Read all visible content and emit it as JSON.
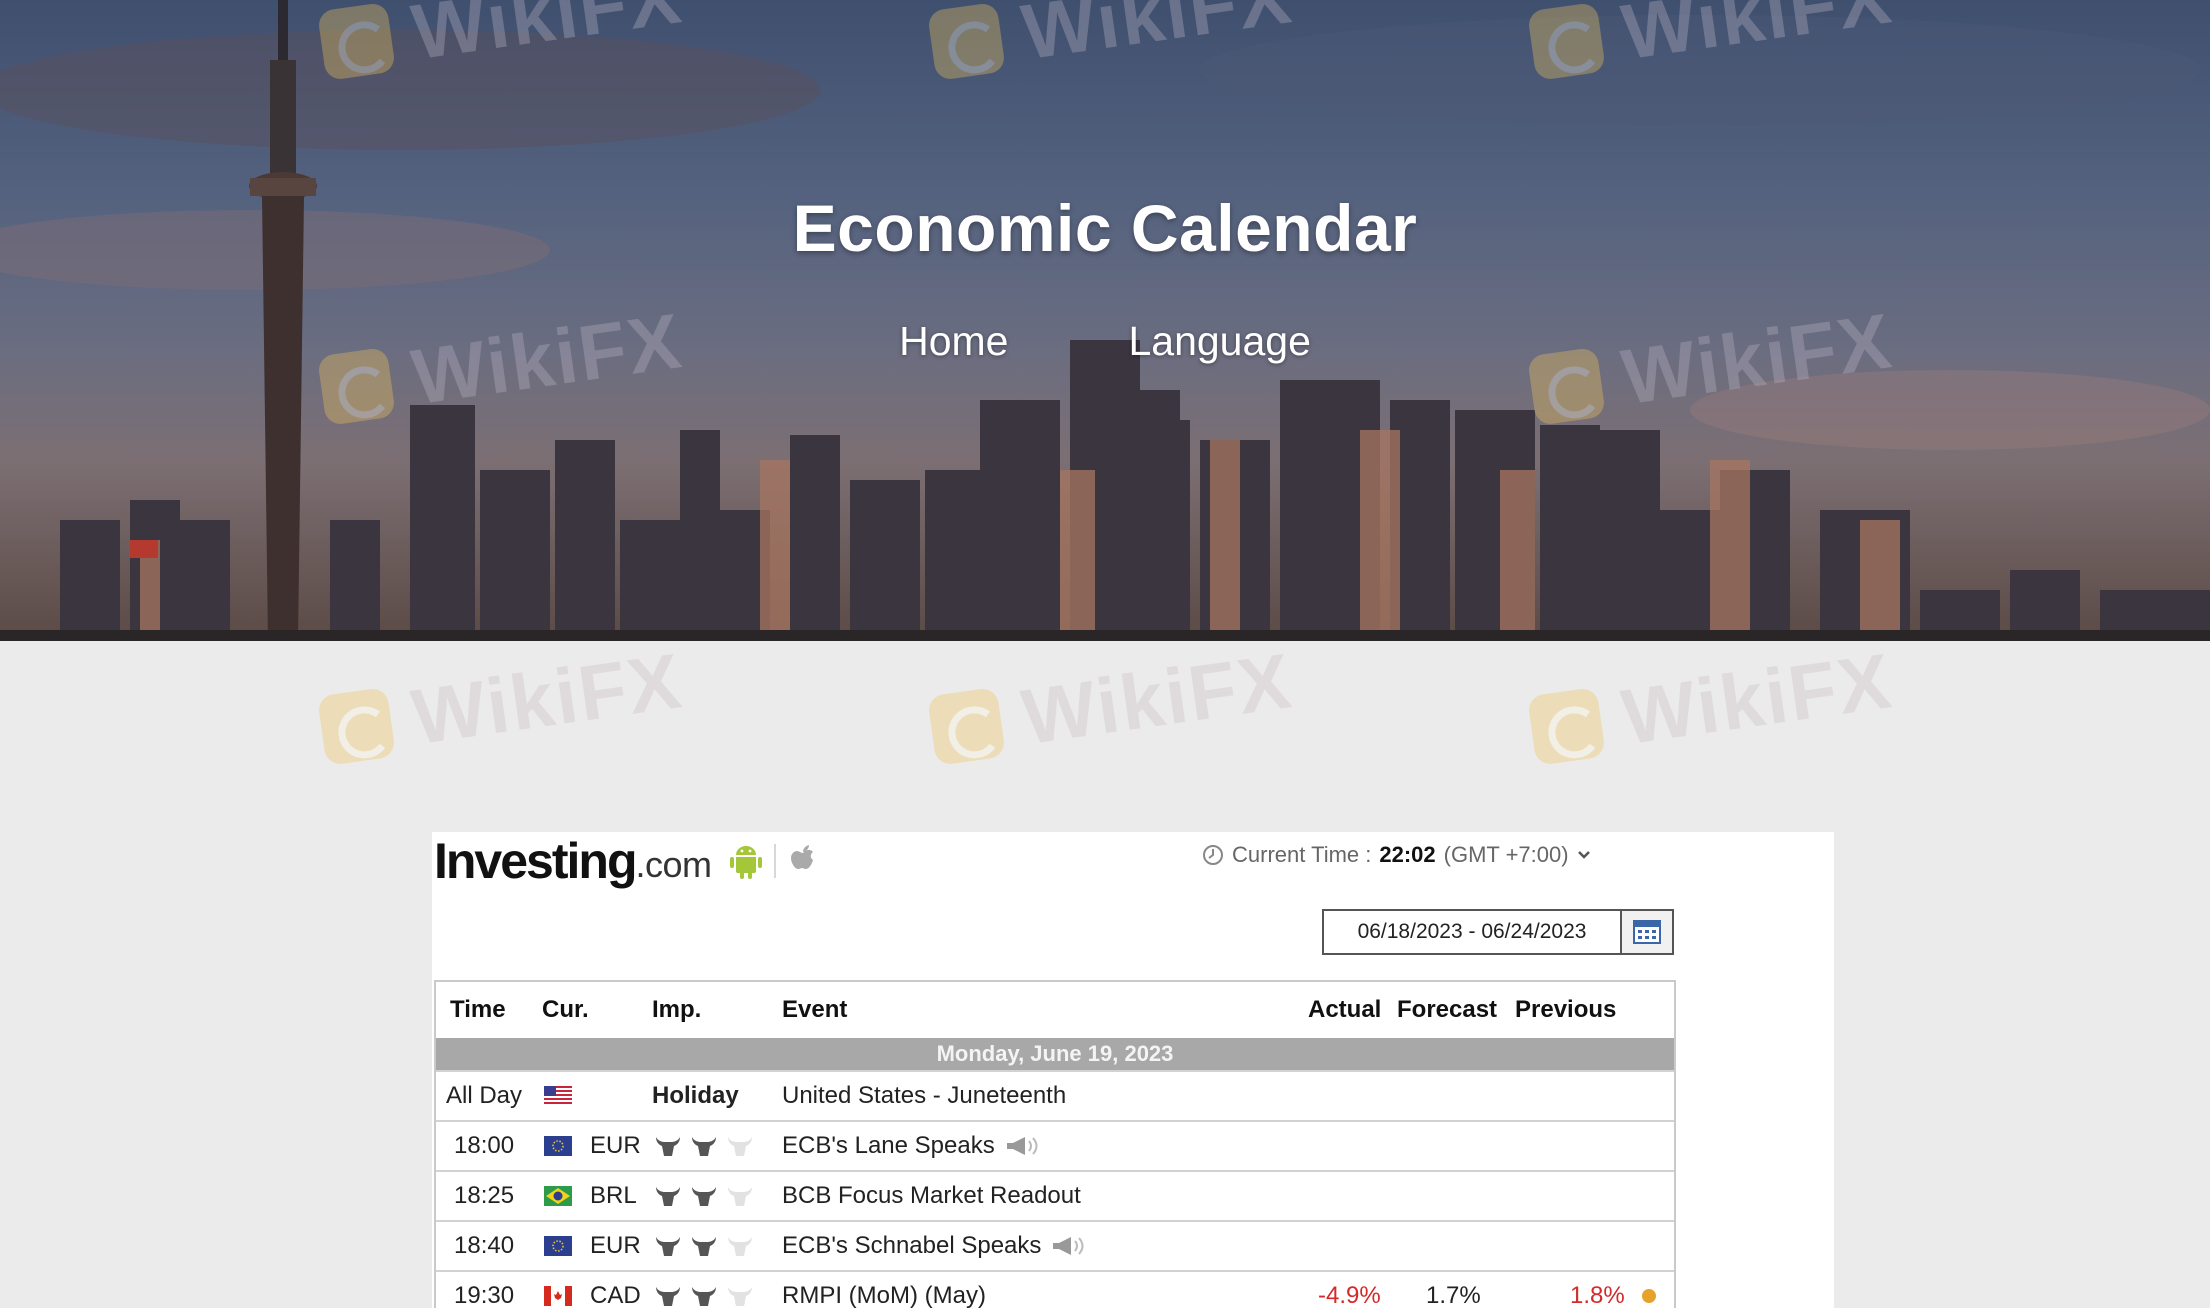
{
  "hero": {
    "title": "Economic Calendar",
    "nav": [
      {
        "label": "Home"
      },
      {
        "label": "Language"
      }
    ]
  },
  "watermark": {
    "text": "WikiFX"
  },
  "widget": {
    "brand": {
      "name": "Investing",
      "suffix": ".com"
    },
    "current_time": {
      "label": "Current Time :",
      "value": "22:02",
      "timezone": "(GMT +7:00)"
    },
    "date_range": "06/18/2023 - 06/24/2023",
    "table": {
      "headers": {
        "time": "Time",
        "currency": "Cur.",
        "importance": "Imp.",
        "event": "Event",
        "actual": "Actual",
        "forecast": "Forecast",
        "previous": "Previous"
      },
      "day_label": "Monday, June 19, 2023",
      "rows": [
        {
          "time": "All Day",
          "flag": "us-flag-icon",
          "currency": "",
          "importance_text": "Holiday",
          "event": "United States - Juneteenth"
        },
        {
          "time": "18:00",
          "flag": "eu-flag-icon",
          "currency": "EUR",
          "importance": 2,
          "event": "ECB's Lane Speaks",
          "speech": true
        },
        {
          "time": "18:25",
          "flag": "br-flag-icon",
          "currency": "BRL",
          "importance": 2,
          "event": "BCB Focus Market Readout"
        },
        {
          "time": "18:40",
          "flag": "eu-flag-icon",
          "currency": "EUR",
          "importance": 2,
          "event": "ECB's Schnabel Speaks",
          "speech": true
        },
        {
          "time": "19:30",
          "flag": "ca-flag-icon",
          "currency": "CAD",
          "importance": 2,
          "event": "RMPI (MoM) (May)",
          "actual": "-4.9%",
          "forecast": "1.7%",
          "previous": "1.8%"
        }
      ]
    }
  },
  "colors": {
    "page_bg": "#ebebeb",
    "day_bar": "#a8a8a8",
    "negative": "#d42a2a",
    "android_green": "#a4c639"
  }
}
